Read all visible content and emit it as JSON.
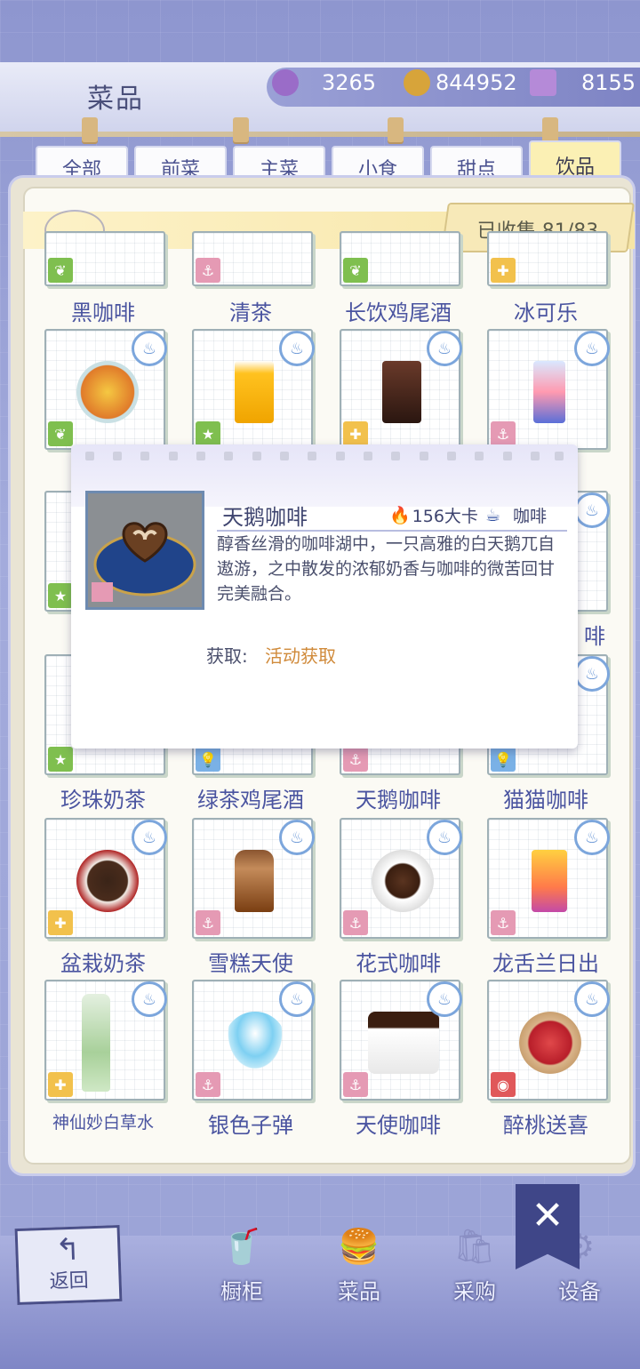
{
  "header": {
    "title": "菜品",
    "currencies": [
      {
        "icon": "purple-gem-icon",
        "value": "3265",
        "color": "#9a6cc8"
      },
      {
        "icon": "gold-coin-icon",
        "value": "844952",
        "color": "#d7a43a"
      },
      {
        "icon": "crystal-plus-icon",
        "value": "8155",
        "color": "#b58ad8"
      }
    ]
  },
  "tabs": [
    {
      "label": "全部",
      "active": false
    },
    {
      "label": "前菜",
      "active": false
    },
    {
      "label": "主菜",
      "active": false
    },
    {
      "label": "小食",
      "active": false
    },
    {
      "label": "甜点",
      "active": false
    },
    {
      "label": "饮品",
      "active": true
    }
  ],
  "collection": {
    "label": "已收集 81/83"
  },
  "rows": [
    {
      "items": [
        {
          "name": "黑咖啡",
          "badge": "leaf-icon",
          "color": "#7fbf4f"
        },
        {
          "name": "清茶",
          "badge": "anchor-icon",
          "color": "#e59ab4"
        },
        {
          "name": "长饮鸡尾酒",
          "badge": "leaf-icon",
          "color": "#7fbf4f"
        },
        {
          "name": "冰可乐",
          "badge": "puzzle-icon",
          "color": "#f2c14c"
        }
      ]
    },
    {
      "items": [
        {
          "name": "",
          "badge": "leaf-icon",
          "color": "#7fbf4f"
        },
        {
          "name": "",
          "badge": "star-icon",
          "color": "#7fbf4f"
        },
        {
          "name": "",
          "badge": "puzzle-icon",
          "color": "#f2c14c"
        },
        {
          "name": "",
          "badge": "anchor-icon",
          "color": "#e59ab4"
        }
      ]
    },
    {
      "items": [
        {
          "name": "",
          "badge": "star-icon",
          "color": "#7fbf4f"
        },
        {
          "name": "",
          "badge": "",
          "color": ""
        },
        {
          "name": "",
          "badge": "",
          "color": ""
        },
        {
          "name": "啡",
          "badge": "",
          "color": ""
        }
      ]
    },
    {
      "items": [
        {
          "name": "珍珠奶茶",
          "badge": "star-icon",
          "color": "#7fbf4f"
        },
        {
          "name": "绿茶鸡尾酒",
          "badge": "bulb-icon",
          "color": "#7ab1e6"
        },
        {
          "name": "天鹅咖啡",
          "badge": "anchor-icon",
          "color": "#e59ab4"
        },
        {
          "name": "猫猫咖啡",
          "badge": "bulb-icon",
          "color": "#7ab1e6"
        }
      ]
    },
    {
      "items": [
        {
          "name": "盆栽奶茶",
          "badge": "puzzle-icon",
          "color": "#f2c14c"
        },
        {
          "name": "雪糕天使",
          "badge": "anchor-icon",
          "color": "#e59ab4"
        },
        {
          "name": "花式咖啡",
          "badge": "anchor-icon",
          "color": "#e59ab4"
        },
        {
          "name": "龙舌兰日出",
          "badge": "anchor-icon",
          "color": "#e59ab4"
        }
      ]
    },
    {
      "items": [
        {
          "name": "神仙妙白草水",
          "badge": "puzzle-icon",
          "color": "#f2c14c"
        },
        {
          "name": "银色子弹",
          "badge": "anchor-icon",
          "color": "#e59ab4"
        },
        {
          "name": "天使咖啡",
          "badge": "anchor-icon",
          "color": "#e59ab4"
        },
        {
          "name": "醉桃送喜",
          "badge": "lantern-icon",
          "color": "#e0585a"
        }
      ]
    }
  ],
  "popup": {
    "title": "天鹅咖啡",
    "kcal": "156大卡",
    "type": "咖啡",
    "description": "醇香丝滑的咖啡湖中，一只高雅的白天鹅兀自遨游，之中散发的浓郁奶香与咖啡的微苦回甘完美融合。",
    "acquire_label": "获取:",
    "acquire_value": "活动获取"
  },
  "bottom_nav": {
    "back": "返回",
    "items": [
      {
        "label": "橱柜",
        "icon": "cabinet-icon"
      },
      {
        "label": "菜品",
        "icon": "burger-icon",
        "active": true
      },
      {
        "label": "采购",
        "icon": "shopping-bag-icon"
      },
      {
        "label": "设备",
        "icon": "equipment-icon"
      }
    ]
  }
}
